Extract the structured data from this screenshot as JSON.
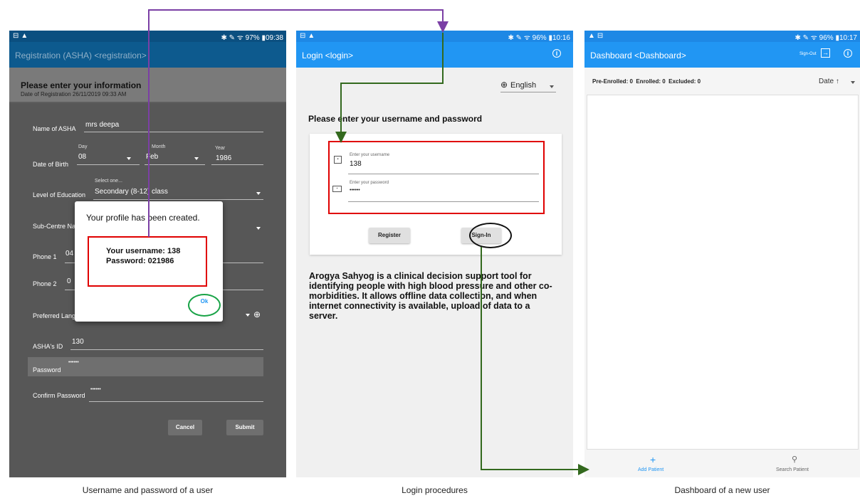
{
  "colors": {
    "primary_blue": "#2196f3",
    "dim_blue": "#0d5a8e",
    "purple_arrow": "#7b3fa5",
    "green_arrow": "#33691e",
    "red_box": "#e00000",
    "green_circle": "#19a347"
  },
  "registration": {
    "status_right": "✱ ✎ ᯤ 97% ▮09:38",
    "app_title": "Registration (ASHA) <registration>",
    "heading": "Please enter your information",
    "date_of_registration": "Date of Registration 26/11/2019 09:33 AM",
    "name_label": "Name of ASHA",
    "name_value": "mrs deepa",
    "dob_label": "Date of Birth",
    "day_hint": "Day",
    "day_value": "08",
    "month_hint": "Month",
    "month_value": "Feb",
    "year_hint": "Year",
    "year_value": "1986",
    "edu_label": "Level of Education",
    "edu_hint": "Select one...",
    "edu_value": "Secondary (8-12) class",
    "subcentre_label": "Sub-Centre Na",
    "phone1_label": "Phone 1",
    "phone1_value": "04",
    "phone2_label": "Phone 2",
    "phone2_value": "0",
    "pref_lang_label": "Preferred Lang",
    "ashaid_label": "ASHA's ID",
    "ashaid_value": "130",
    "password_label": "Password",
    "password_value": "••••••",
    "confirm_label": "Confirm Password",
    "confirm_value": "••••••",
    "cancel_label": "Cancel",
    "submit_label": "Submit",
    "dialog": {
      "title": "Your profile has been created.",
      "username_line": "Your username: 138",
      "password_line": "Password: 021986",
      "ok_label": "Ok"
    },
    "caption": "Username and password of a user"
  },
  "login": {
    "status_right": "✱ ✎ ᯤ 96% ▮10:16",
    "app_title": "Login <login>",
    "language": "English",
    "heading": "Please enter your username and password",
    "username_hint": "Enter your username",
    "username_value": "138",
    "password_hint": "Enter your password",
    "password_value": "••••••",
    "register_label": "Register",
    "signin_label": "Sign-In",
    "description": "Arogya Sahyog is a clinical decision support tool for identifying people with high blood pressure and other co-morbidities. It allows offline data collection, and when internet connectivity is available, upload of data to a server.",
    "caption": "Login procedures"
  },
  "dashboard": {
    "status_right": "✱ ✎ ᯤ 96% ▮10:17",
    "app_title": "Dashboard <Dashboard>",
    "signout_label": "Sign-Out",
    "counts": "Pre-Enrolled: 0  Enrolled: 0  Excluded: 0",
    "sort_label": "Date ↑",
    "add_patient_label": "Add Patient",
    "search_patient_label": "Search Patient",
    "caption": "Dashboard of a new user"
  }
}
